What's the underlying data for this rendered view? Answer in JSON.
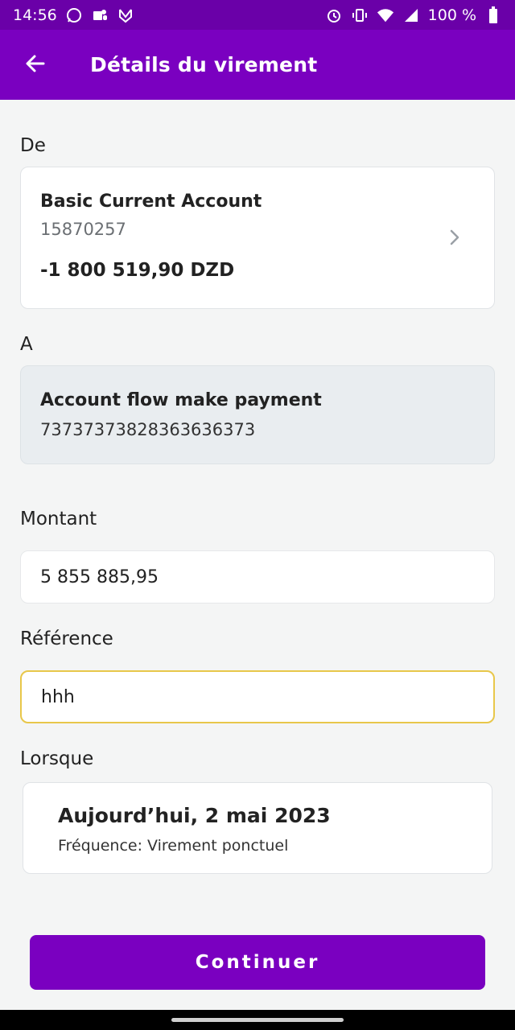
{
  "status_bar": {
    "time": "14:56",
    "battery": "100 %",
    "left_icons": [
      "whatsapp-icon",
      "teams-icon",
      "shield-app-icon"
    ],
    "right_icons": [
      "alarm-icon",
      "vibrate-icon",
      "wifi-icon",
      "signal-icon",
      "battery-icon"
    ]
  },
  "app_bar": {
    "title": "Détails du virement",
    "back_icon": "arrow-left-icon"
  },
  "from_section": {
    "label": "De",
    "account_name": "Basic Current Account",
    "account_number": "15870257",
    "balance": "-1 800 519,90 DZD",
    "chevron_icon": "chevron-right-icon"
  },
  "to_section": {
    "label": "A",
    "account_name": "Account flow make payment",
    "account_number": "73737373828363636373"
  },
  "amount_section": {
    "label": "Montant",
    "value": "5 855 885,95"
  },
  "reference_section": {
    "label": "Référence",
    "value": "hhh"
  },
  "when_section": {
    "label": "Lorsque",
    "date": "Aujourd’hui, 2 mai 2023",
    "frequency": "Fréquence: Virement ponctuel"
  },
  "continue_button": {
    "label": "Continuer"
  },
  "colors": {
    "brand_purple": "#7a00c0",
    "status_purple": "#6a00a8",
    "focus_border": "#e8c74a"
  }
}
